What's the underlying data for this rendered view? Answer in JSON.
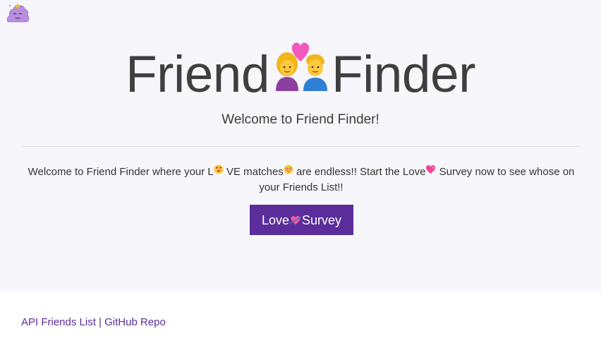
{
  "hero": {
    "title_left": "Friend",
    "title_right": "Finder",
    "subtitle": "Welcome to Friend Finder!",
    "lead": {
      "part1": "Welcome to Friend Finder where your L",
      "part2": "VE matches",
      "part3": " are endless!! Start the Love",
      "part4": "Survey now to see whose on your Friends List!!"
    },
    "button": {
      "label_left": "Love",
      "label_right": "Survey"
    }
  },
  "icons": {
    "logo": "lumpy-space-princess-icon",
    "couple": "couple-with-heart-icon",
    "heart_eyes": "heart-eyes-emoji-icon",
    "flushed": "flushed-face-emoji-icon",
    "sparkling_heart": "sparkling-heart-icon",
    "heart_arrow": "heart-with-arrow-icon"
  },
  "footer": {
    "api_link": "API Friends List",
    "separator": "|",
    "github_link": "GitHub Repo"
  },
  "colors": {
    "accent": "#5b2d9a",
    "hero_bg": "#f7f6fb",
    "page_bg": "#ffffff"
  }
}
